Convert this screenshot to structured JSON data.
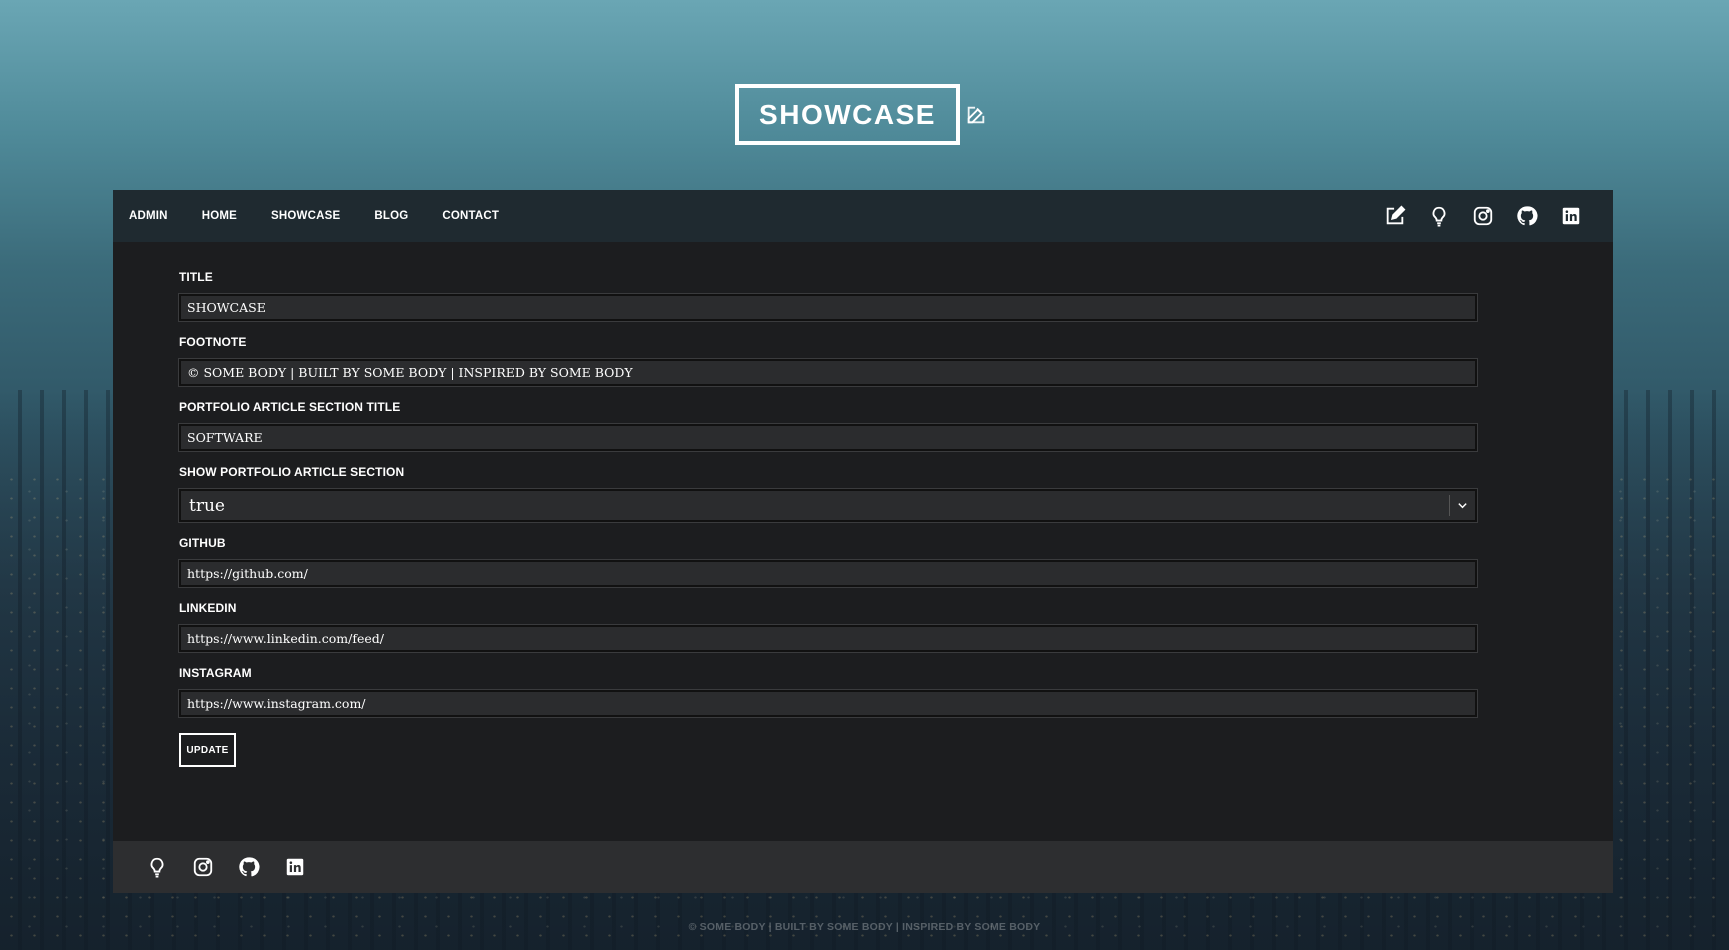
{
  "brand": {
    "title": "SHOWCASE"
  },
  "nav": {
    "items": [
      "ADMIN",
      "HOME",
      "SHOWCASE",
      "BLOG",
      "CONTACT"
    ],
    "icons": [
      "edit-icon",
      "lightbulb-icon",
      "instagram-icon",
      "github-icon",
      "linkedin-icon"
    ]
  },
  "form": {
    "title_label": "TITLE",
    "title_value": "SHOWCASE",
    "footnote_label": "FOOTNOTE",
    "footnote_value": "© SOME BODY | BUILT BY SOME BODY | INSPIRED BY SOME BODY",
    "portfolio_title_label": "PORTFOLIO ARTICLE SECTION TITLE",
    "portfolio_title_value": "SOFTWARE",
    "show_portfolio_label": "SHOW PORTFOLIO ARTICLE SECTION",
    "show_portfolio_value": "true",
    "github_label": "GITHUB",
    "github_value": "https://github.com/",
    "linkedin_label": "LINKEDIN",
    "linkedin_value": "https://www.linkedin.com/feed/",
    "instagram_label": "INSTAGRAM",
    "instagram_value": "https://www.instagram.com/",
    "update_label": "UPDATE"
  },
  "footer": {
    "icons": [
      "lightbulb-icon",
      "instagram-icon",
      "github-icon",
      "linkedin-icon"
    ],
    "copyright": "© SOME BODY | BUILT BY SOME BODY | INSPIRED BY SOME BODY"
  },
  "colors": {
    "panel_bg": "#1c1d1f",
    "nav_bg": "#1f2a30",
    "input_bg": "#2b2c2e",
    "footer_bg": "#2d2e30"
  }
}
